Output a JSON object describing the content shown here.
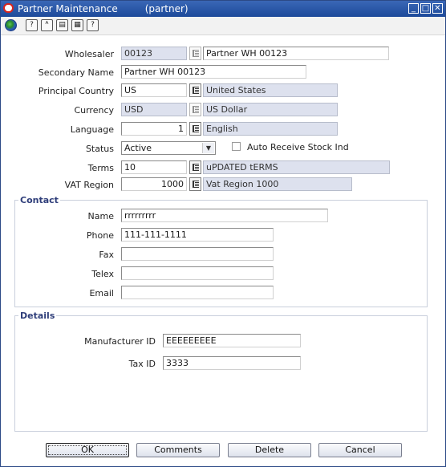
{
  "window": {
    "title": "Partner Maintenance",
    "subtitle": "(partner)",
    "minimize": "_",
    "maximize": "□",
    "close": "✕"
  },
  "toolbar": {
    "icons": [
      "globe-icon",
      "help-icon",
      "spellcheck-icon",
      "notes-icon",
      "print-icon",
      "question-icon"
    ],
    "glyphs": [
      "",
      "?",
      "ᴬ",
      "▤",
      "▦",
      "?"
    ]
  },
  "form": {
    "wholesaler": {
      "label": "Wholesaler",
      "id": "00123",
      "name": "Partner WH 00123"
    },
    "secondary_name": {
      "label": "Secondary Name",
      "value": "Partner WH 00123"
    },
    "principal_country": {
      "label": "Principal Country",
      "code": "US",
      "name": "United States"
    },
    "currency": {
      "label": "Currency",
      "code": "USD",
      "name": "US Dollar"
    },
    "language": {
      "label": "Language",
      "code": "1",
      "name": "English"
    },
    "status": {
      "label": "Status",
      "value": "Active"
    },
    "auto_receive": {
      "label": "Auto Receive Stock Ind",
      "checked": false
    },
    "terms": {
      "label": "Terms",
      "code": "10",
      "name": "uPDATED tERMS"
    },
    "vat_region": {
      "label": "VAT Region",
      "code": "1000",
      "name": "Vat Region 1000"
    }
  },
  "contact": {
    "title": "Contact",
    "name": {
      "label": "Name",
      "value": "rrrrrrrrr"
    },
    "phone": {
      "label": "Phone",
      "value": "111-111-1111"
    },
    "fax": {
      "label": "Fax",
      "value": ""
    },
    "telex": {
      "label": "Telex",
      "value": ""
    },
    "email": {
      "label": "Email",
      "value": ""
    }
  },
  "details": {
    "title": "Details",
    "manufacturer_id": {
      "label": "Manufacturer ID",
      "value": "EEEEEEEEE"
    },
    "tax_id": {
      "label": "Tax ID",
      "value": "3333"
    }
  },
  "buttons": {
    "ok": "OK",
    "comments": "Comments",
    "delete": "Delete",
    "cancel": "Cancel"
  },
  "colors": {
    "titlebar": "#1d4a9a",
    "readonly_field": "#dde1ee",
    "group_title": "#2f3e7a"
  }
}
